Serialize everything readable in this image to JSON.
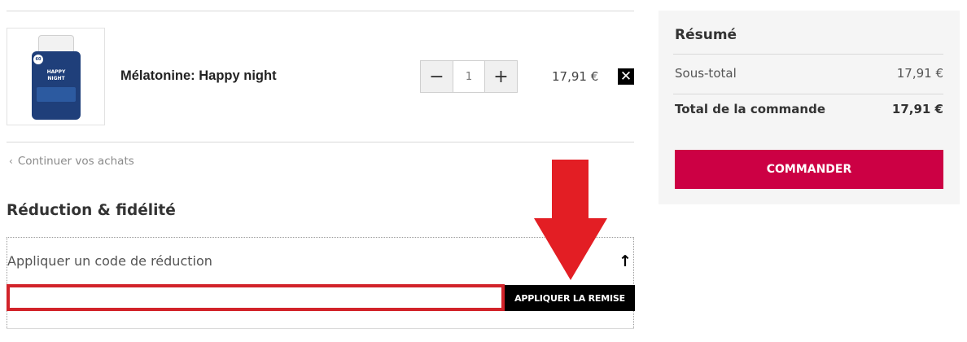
{
  "product": {
    "name": "Mélatonine: Happy night",
    "image_label_line1": "HAPPY",
    "image_label_line2": "NIGHT",
    "image_badge": "60",
    "quantity": "1",
    "price": "17,91 €",
    "remove_symbol": "✕",
    "minus_symbol": "−",
    "plus_symbol": "+"
  },
  "continue_link": {
    "label": "Continuer vos achats",
    "icon": "chevron-left-icon"
  },
  "reduction": {
    "title": "Réduction & fidélité",
    "coupon_label": "Appliquer un code de réduction",
    "collapse_icon": "arrow-up-icon",
    "input_value": "",
    "input_placeholder": "",
    "apply_label": "APPLIQUER LA REMISE"
  },
  "annotation": {
    "icon": "big-arrow-down-icon",
    "color": "#e31e24"
  },
  "summary": {
    "title": "Résumé",
    "subtotal_label": "Sous-total",
    "subtotal_value": "17,91 €",
    "total_label": "Total de la commande",
    "total_value": "17,91 €",
    "order_label": "COMMANDER"
  },
  "colors": {
    "order_button": "#cc0044",
    "highlight_box": "#d2232a"
  }
}
